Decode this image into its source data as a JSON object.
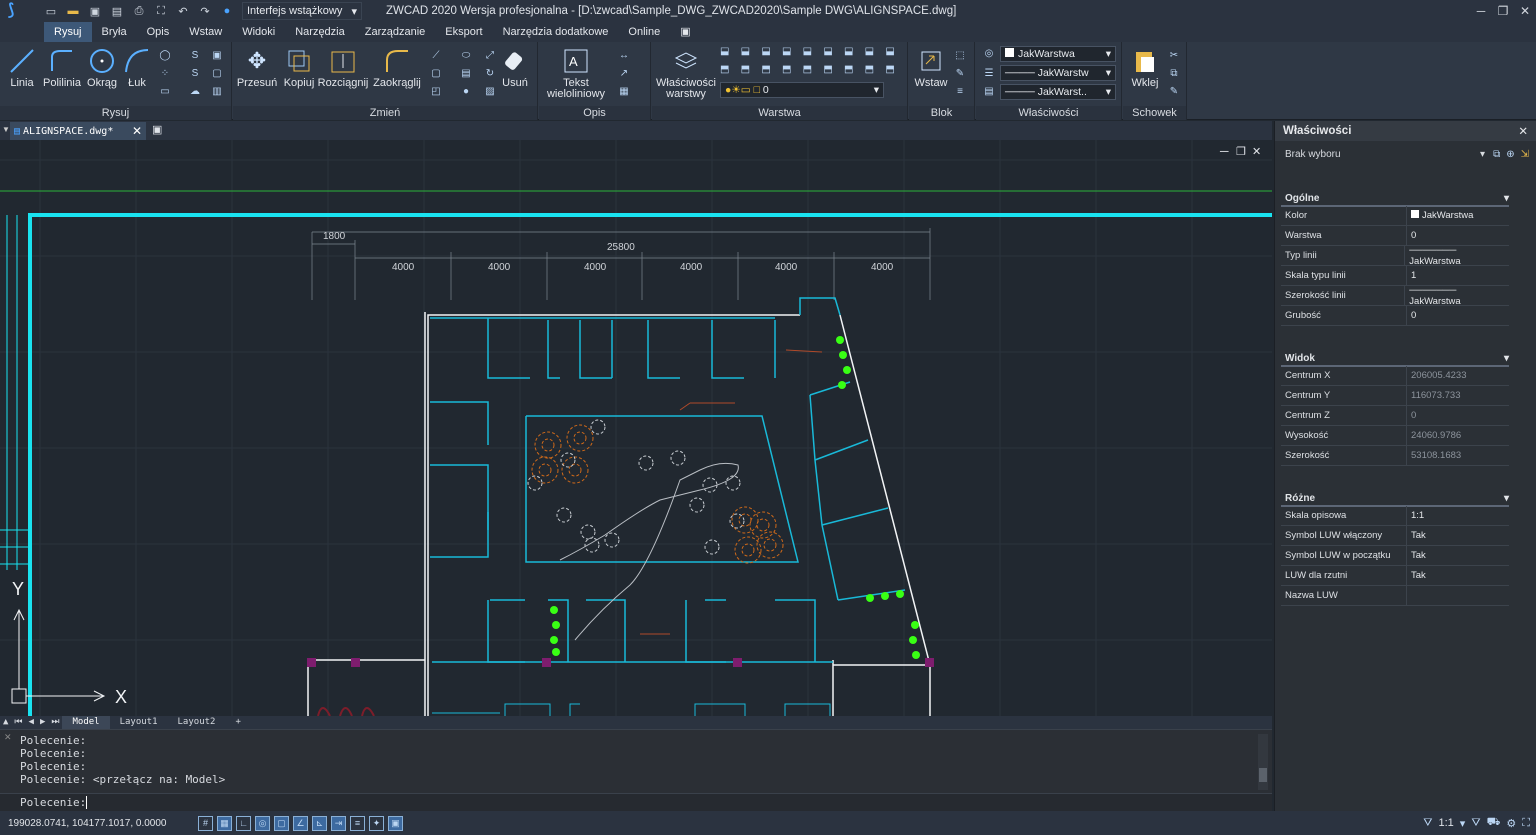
{
  "titlebar": {
    "workspace": "Interfejs wstążkowy",
    "title": "ZWCAD 2020 Wersja profesjonalna - [D:\\zwcad\\Sample_DWG_ZWCAD2020\\Sample DWG\\ALIGNSPACE.dwg]"
  },
  "menu": [
    "Rysuj",
    "Bryła",
    "Opis",
    "Wstaw",
    "Widoki",
    "Narzędzia",
    "Zarządzanie",
    "Eksport",
    "Narzędzia dodatkowe",
    "Online"
  ],
  "ribbon": {
    "draw": {
      "label": "Rysuj",
      "linia": "Linia",
      "polilinia": "Polilinia",
      "okrag": "Okrąg",
      "luk": "Łuk"
    },
    "modify": {
      "label": "Zmień",
      "przesun": "Przesuń",
      "kopiuj": "Kopiuj",
      "rozciagnij": "Rozciągnij",
      "zaokraglij": "Zaokrąglij",
      "usun": "Usuń"
    },
    "annot": {
      "label": "Opis",
      "tekst1": "Tekst",
      "tekst2": "wieloliniowy"
    },
    "layers": {
      "label": "Warstwa",
      "wl1": "Właściwości",
      "wl2": "warstwy",
      "layer_value": "0"
    },
    "block": {
      "label": "Blok",
      "wstaw": "Wstaw"
    },
    "props": {
      "label": "Właściwości",
      "color": "JakWarstwa",
      "ltype": "JakWarstw",
      "lweight": "JakWarst.."
    },
    "clip": {
      "label": "Schowek",
      "wklej": "Wklej"
    }
  },
  "doc": {
    "tab": "ALIGNSPACE.dwg*"
  },
  "drawing": {
    "dim_total": "25800",
    "dim_left": "1800",
    "dims": [
      "4000",
      "4000",
      "4000",
      "4000",
      "4000",
      "4000"
    ],
    "axis_x": "X",
    "axis_y": "Y"
  },
  "layouts": [
    "Model",
    "Layout1",
    "Layout2",
    "+"
  ],
  "command": {
    "history": [
      "Polecenie:",
      "Polecenie:",
      "Polecenie:",
      "Polecenie: <przełącz na: Model>"
    ],
    "prompt": "Polecenie:"
  },
  "status": {
    "coords": "199028.0741, 104177.1017, 0.0000",
    "scale": "1:1"
  },
  "properties": {
    "title": "Właściwości",
    "selection": "Brak wyboru",
    "general": {
      "title": "Ogólne",
      "rows": [
        [
          "Kolor",
          "JakWarstwa"
        ],
        [
          "Warstwa",
          "0"
        ],
        [
          "Typ linii",
          "JakWarstwa"
        ],
        [
          "Skala typu linii",
          "1"
        ],
        [
          "Szerokość linii",
          "JakWarstwa"
        ],
        [
          "Grubość",
          "0"
        ]
      ]
    },
    "view": {
      "title": "Widok",
      "rows": [
        [
          "Centrum X",
          "206005.4233"
        ],
        [
          "Centrum Y",
          "116073.733"
        ],
        [
          "Centrum Z",
          "0"
        ],
        [
          "Wysokość",
          "24060.9786"
        ],
        [
          "Szerokość",
          "53108.1683"
        ]
      ]
    },
    "misc": {
      "title": "Różne",
      "rows": [
        [
          "Skala opisowa",
          "1:1"
        ],
        [
          "Symbol LUW włączony",
          "Tak"
        ],
        [
          "Symbol LUW w początku",
          "Tak"
        ],
        [
          "LUW dla rzutni",
          "Tak"
        ],
        [
          "Nazwa LUW",
          ""
        ]
      ]
    }
  },
  "colors": {
    "accent": "#3d5878",
    "wall": "#19e3f0",
    "cad_bg": "#212830",
    "plant": "#39ff14",
    "furniture_orange": "#d06a1a"
  }
}
